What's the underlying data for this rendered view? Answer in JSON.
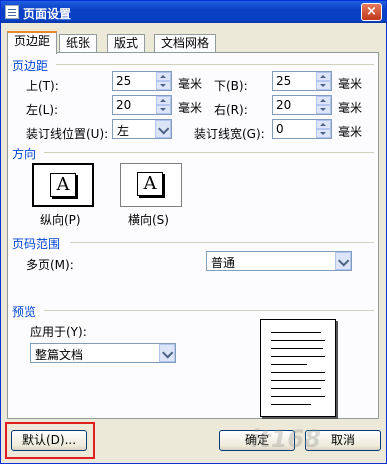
{
  "window": {
    "title": "页面设置",
    "close_label": "×"
  },
  "tabs": [
    "页边距",
    "纸张",
    "版式",
    "文档网格"
  ],
  "margins": {
    "section_title": "页边距",
    "top": {
      "label": "上(T):",
      "value": "25",
      "unit": "毫米"
    },
    "bottom": {
      "label": "下(B):",
      "value": "25",
      "unit": "毫米"
    },
    "left": {
      "label": "左(L):",
      "value": "20",
      "unit": "毫米"
    },
    "right": {
      "label": "右(R):",
      "value": "20",
      "unit": "毫米"
    },
    "gutter_pos": {
      "label": "装订线位置(U):",
      "value": "左"
    },
    "gutter_width": {
      "label": "装订线宽(G):",
      "value": "0",
      "unit": "毫米"
    }
  },
  "orientation": {
    "section_title": "方向",
    "portrait": {
      "glyph": "A",
      "label": "纵向(P)"
    },
    "landscape": {
      "glyph": "A",
      "label": "横向(S)"
    }
  },
  "pages": {
    "section_title": "页码范围",
    "multi_label": "多页(M):",
    "multi_value": "普通"
  },
  "preview": {
    "section_title": "预览",
    "apply_label": "应用于(Y):",
    "apply_value": "整篇文档"
  },
  "buttons": {
    "default": "默认(D)...",
    "ok": "确定",
    "cancel": "取消"
  },
  "watermark": "it168"
}
